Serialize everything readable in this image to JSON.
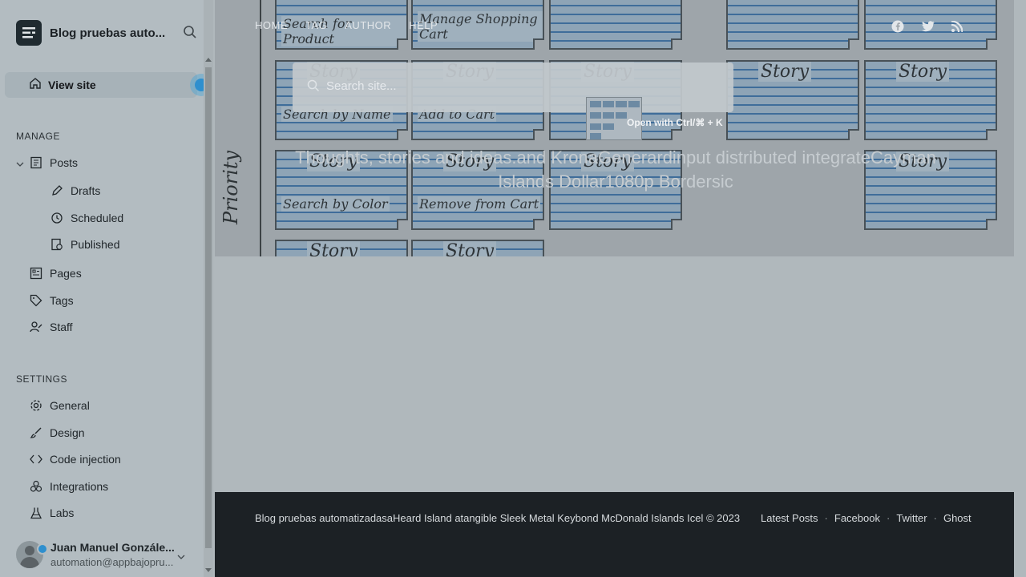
{
  "sidebar": {
    "site_title": "Blog pruebas auto...",
    "view_site": "View site",
    "manage_title": "MANAGE",
    "settings_title": "SETTINGS",
    "manage_items": [
      {
        "label": "Posts",
        "icon": "posts-icon"
      },
      {
        "label": "Drafts",
        "icon": "pencil-icon"
      },
      {
        "label": "Scheduled",
        "icon": "clock-icon"
      },
      {
        "label": "Published",
        "icon": "published-icon"
      },
      {
        "label": "Pages",
        "icon": "pages-icon"
      },
      {
        "label": "Tags",
        "icon": "tag-icon"
      },
      {
        "label": "Staff",
        "icon": "staff-icon"
      }
    ],
    "settings_items": [
      {
        "label": "General",
        "icon": "gear-icon"
      },
      {
        "label": "Design",
        "icon": "brush-icon"
      },
      {
        "label": "Code injection",
        "icon": "code-icon"
      },
      {
        "label": "Integrations",
        "icon": "integrations-icon"
      },
      {
        "label": "Labs",
        "icon": "flask-icon"
      }
    ],
    "user": {
      "name": "Juan Manuel Gonzále...",
      "email": "automation@appbajopru..."
    }
  },
  "main": {
    "nav": [
      "HOME",
      "TAG",
      "AUTHOR",
      "HELP"
    ],
    "search_placeholder": "Search site...",
    "open_with": "Open with Ctrl/⌘ + K",
    "tagline": "Thoughts, stories and ideas.and KronaGenerardinput distributed integrateCayman Islands Dollar1080p Bordersic",
    "hero_image": {
      "vertical_label": "Priority",
      "card_title": "Story",
      "card_notes": [
        "Search for Product",
        "Manage Shopping Cart",
        "Search by Name",
        "Add to Cart",
        "Search by Color",
        "Remove from Cart"
      ]
    },
    "footer": {
      "text": "Blog pruebas automatizadasaHeard Island atangible Sleek Metal Keybond McDonald Islands Icel © 2023",
      "links": [
        "Latest Posts",
        "Facebook",
        "Twitter",
        "Ghost"
      ]
    }
  },
  "colors": {
    "accent": "#2e8fce",
    "footer_bg": "#1c2125",
    "sidebar_bg": "#b3bcc1"
  }
}
